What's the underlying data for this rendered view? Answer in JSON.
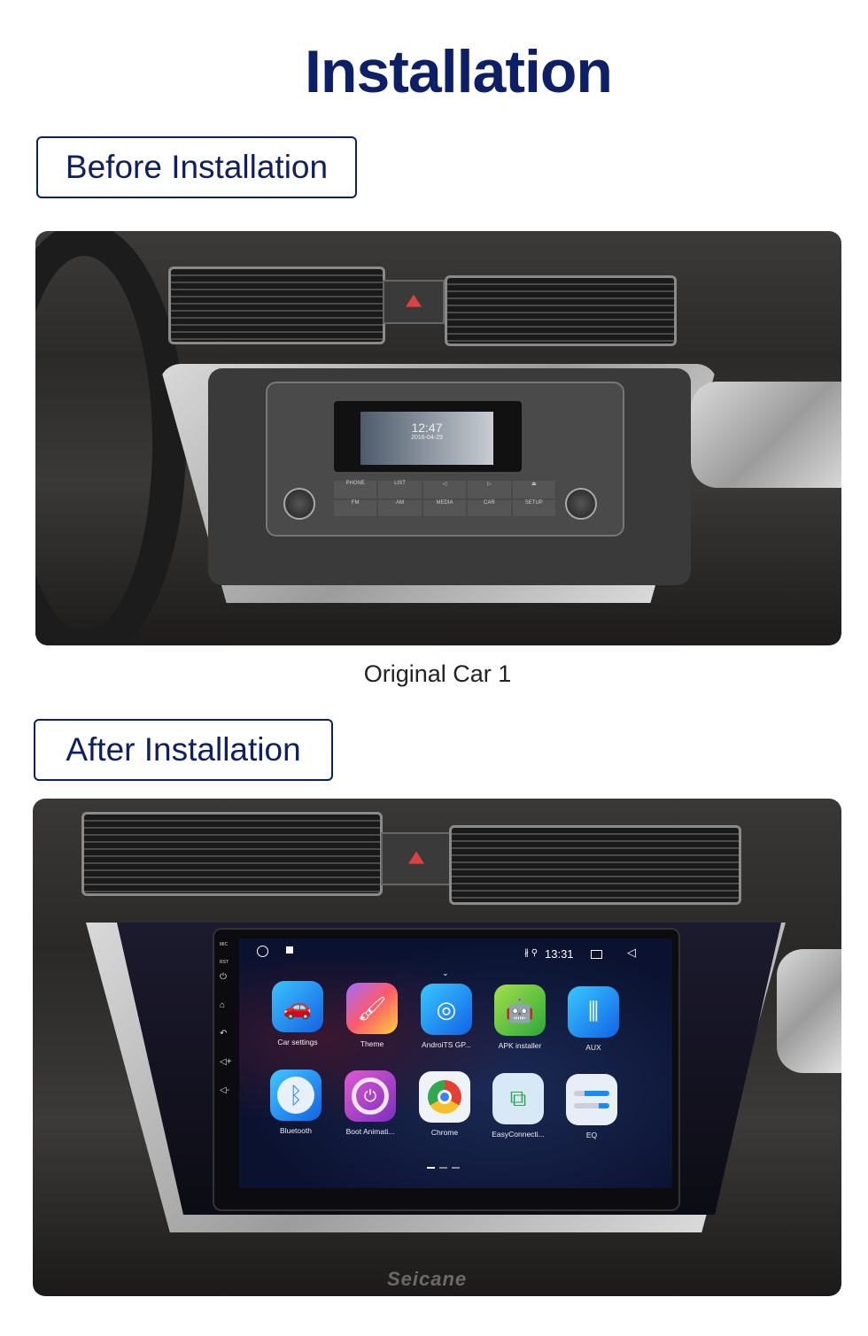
{
  "page": {
    "title": "Installation",
    "accent_color": "#0d1f66"
  },
  "before": {
    "heading": "Before Installation",
    "caption": "Original Car  1",
    "radio": {
      "time": "12:47",
      "date": "2016-04-29",
      "buttons": [
        "PHONE",
        "LIST",
        "◁",
        "▷",
        "⏏",
        "FM",
        "AM",
        "MEDIA",
        "CAR",
        "SETUP"
      ]
    }
  },
  "after": {
    "heading": "After Installation",
    "screen": {
      "side_labels": [
        "MIC",
        "RST"
      ],
      "side_icons": [
        "power-icon",
        "home-icon",
        "back-icon",
        "volume-up-icon",
        "volume-down-icon"
      ],
      "time": "13:31",
      "status_icons": [
        "bluetooth-icon",
        "location-icon"
      ],
      "apps": [
        {
          "label": "Car settings",
          "icon": "car-settings-icon",
          "color": "#1e7fe8"
        },
        {
          "label": "Theme",
          "icon": "theme-brush-icon",
          "color": "#ee5d8a"
        },
        {
          "label": "AndroiTS GP...",
          "icon": "gps-radar-icon",
          "color": "#1a8cf0"
        },
        {
          "label": "APK installer",
          "icon": "android-icon",
          "color": "#4fbf3a"
        },
        {
          "label": "AUX",
          "icon": "aux-jack-icon",
          "color": "#1b7ff0"
        },
        {
          "label": "Bluetooth",
          "icon": "bluetooth-icon",
          "color": "#2a8df0"
        },
        {
          "label": "Boot Animati...",
          "icon": "power-icon",
          "color": "#a23fc8"
        },
        {
          "label": "Chrome",
          "icon": "chrome-icon",
          "color": "#e8eef5"
        },
        {
          "label": "EasyConnecti...",
          "icon": "easyconnect-icon",
          "color": "#dbeaf6"
        },
        {
          "label": "EQ",
          "icon": "eq-slider-icon",
          "color": "#e6eef6"
        }
      ],
      "page_indicator": {
        "pages": 3,
        "current": 1
      }
    },
    "watermark": "Seicane"
  }
}
